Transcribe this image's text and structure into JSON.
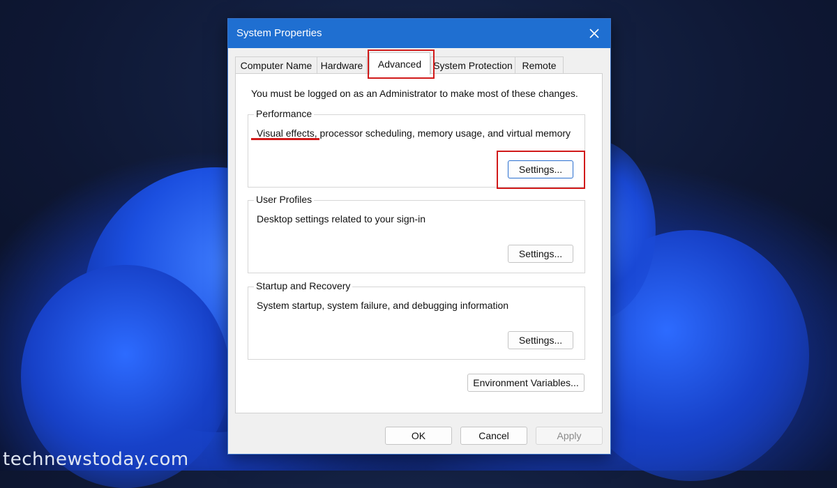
{
  "window": {
    "title": "System Properties",
    "close_icon": "close-icon"
  },
  "tabs": [
    {
      "label": "Computer Name"
    },
    {
      "label": "Hardware"
    },
    {
      "label": "Advanced",
      "active": true
    },
    {
      "label": "System Protection"
    },
    {
      "label": "Remote"
    }
  ],
  "advanced": {
    "note": "You must be logged on as an Administrator to make most of these changes.",
    "groups": [
      {
        "title": "Performance",
        "description": "Visual effects, processor scheduling, memory usage, and virtual memory",
        "button": "Settings..."
      },
      {
        "title": "User Profiles",
        "description": "Desktop settings related to your sign-in",
        "button": "Settings..."
      },
      {
        "title": "Startup and Recovery",
        "description": "System startup, system failure, and debugging information",
        "button": "Settings..."
      }
    ],
    "env_button": "Environment Variables..."
  },
  "footer": {
    "ok": "OK",
    "cancel": "Cancel",
    "apply": "Apply"
  },
  "watermark": "technewstoday.com",
  "colors": {
    "titlebar": "#1f6fd1",
    "highlight": "#d11a1a"
  }
}
